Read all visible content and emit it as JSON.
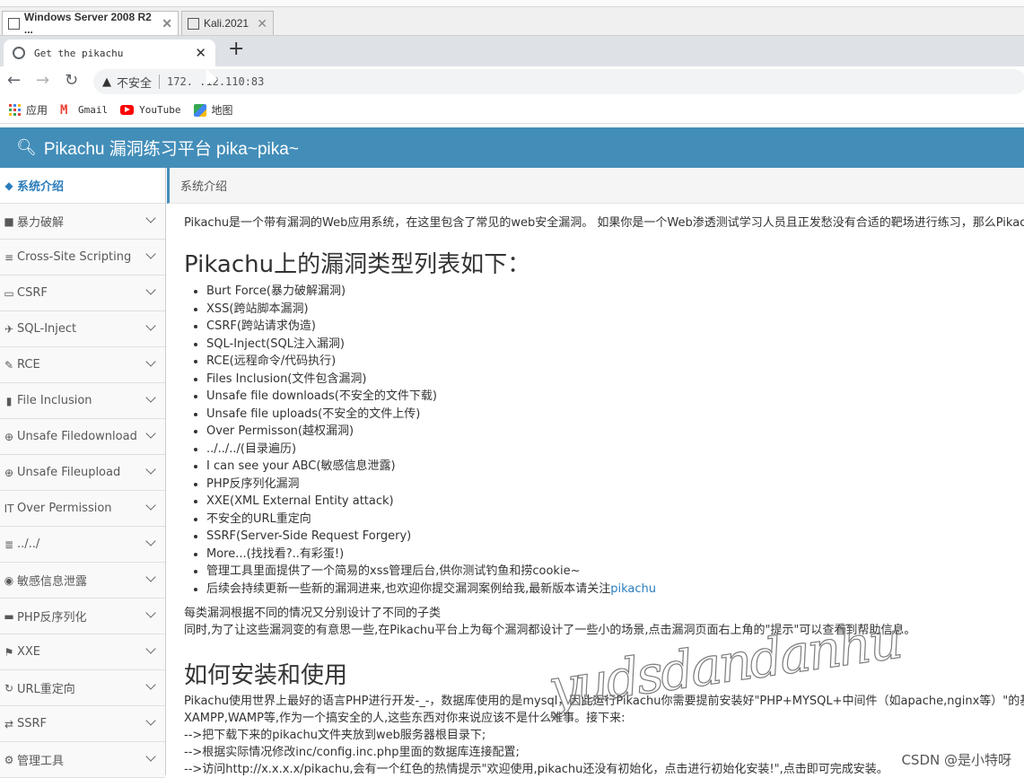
{
  "vm_tabs": [
    {
      "label": "Windows Server 2008 R2 ...",
      "active": true
    },
    {
      "label": "Kali.2021",
      "active": false
    }
  ],
  "browser": {
    "tab_title": "Get the pikachu",
    "insecure_label": "不安全",
    "url": "172.​  .12.110:83",
    "bookmarks": [
      {
        "label": "应用",
        "icon": "apps-grid-icon"
      },
      {
        "label": "Gmail",
        "icon": "gmail-icon"
      },
      {
        "label": "YouTube",
        "icon": "youtube-icon"
      },
      {
        "label": "地图",
        "icon": "maps-icon"
      }
    ]
  },
  "header": {
    "title": "Pikachu 漏洞练习平台 pika~pika~"
  },
  "sidebar": {
    "items": [
      {
        "label": "系统介绍",
        "icon": "tag-icon",
        "active": true
      },
      {
        "label": "暴力破解",
        "icon": "lock-icon"
      },
      {
        "label": "Cross-Site Scripting",
        "icon": "list-icon"
      },
      {
        "label": "CSRF",
        "icon": "credit-card-icon"
      },
      {
        "label": "SQL-Inject",
        "icon": "plane-icon"
      },
      {
        "label": "RCE",
        "icon": "pencil-icon"
      },
      {
        "label": "File Inclusion",
        "icon": "file-icon"
      },
      {
        "label": "Unsafe Filedownload",
        "icon": "download-circle-icon"
      },
      {
        "label": "Unsafe Fileupload",
        "icon": "upload-circle-icon"
      },
      {
        "label": "Over Permission",
        "icon": "text-height-icon"
      },
      {
        "label": "../../",
        "icon": "align-icon"
      },
      {
        "label": "敏感信息泄露",
        "icon": "camera-icon"
      },
      {
        "label": "PHP反序列化",
        "icon": "php-icon"
      },
      {
        "label": "XXE",
        "icon": "flag-icon"
      },
      {
        "label": "URL重定向",
        "icon": "refresh-icon"
      },
      {
        "label": "SSRF",
        "icon": "exchange-icon"
      },
      {
        "label": "管理工具",
        "icon": "gear-icon"
      }
    ]
  },
  "breadcrumb": "系统介绍",
  "main": {
    "intro": "Pikachu是一个带有漏洞的Web应用系统，在这里包含了常见的web安全漏洞。 如果你是一个Web渗透测试学习人员且正发愁没有合适的靶场进行练习，那么Pikach",
    "heading1": "Pikachu上的漏洞类型列表如下：",
    "vuln_list": [
      "Burt Force(暴力破解漏洞)",
      "XSS(跨站脚本漏洞)",
      "CSRF(跨站请求伪造)",
      "SQL-Inject(SQL注入漏洞)",
      "RCE(远程命令/代码执行)",
      "Files Inclusion(文件包含漏洞)",
      "Unsafe file downloads(不安全的文件下载)",
      "Unsafe file uploads(不安全的文件上传)",
      "Over Permisson(越权漏洞)",
      "../../../(目录遍历)",
      "I can see your ABC(敏感信息泄露)",
      "PHP反序列化漏洞",
      "XXE(XML External Entity attack)",
      "不安全的URL重定向",
      "SSRF(Server-Side Request Forgery)",
      "More...(找找看?..有彩蛋!)",
      "管理工具里面提供了一个简易的xss管理后台,供你测试钓鱼和捞cookie~"
    ],
    "last_item_text": "后续会持续更新一些新的漏洞进来,也欢迎你提交漏洞案例给我,最新版本请关注",
    "last_item_link": "pikachu",
    "para1_line1": "每类漏洞根据不同的情况又分别设计了不同的子类",
    "para1_line2": "同时,为了让这些漏洞变的有意思一些,在Pikachu平台上为每个漏洞都设计了一些小的场景,点击漏洞页面右上角的\"提示\"可以查看到帮助信息。",
    "heading2": "如何安装和使用",
    "install_lines": [
      "Pikachu使用世界上最好的语言PHP进行开发-_-，数据库使用的是mysql，因此运行Pikachu你需要提前安装好\"PHP+MYSQL+中间件（如apache,nginx等）\"的基础环",
      "XAMPP,WAMP等,作为一个搞安全的人,这些东西对你来说应该不是什么难事。接下来:",
      "-->把下载下来的pikachu文件夹放到web服务器根目录下;",
      "-->根据实际情况修改inc/config.inc.php里面的数据库连接配置;",
      "-->访问http://x.x.x.x/pikachu,会有一个红色的热情提示\"欢迎使用,pikachu还没有初始化，点击进行初始化安装!\",点击即可完成安装。"
    ]
  },
  "watermark": "yudsdandanhu",
  "csdn_credit": "CSDN @是小特呀",
  "colors": {
    "header": "#438eb9",
    "active_link": "#2b7dbc"
  }
}
